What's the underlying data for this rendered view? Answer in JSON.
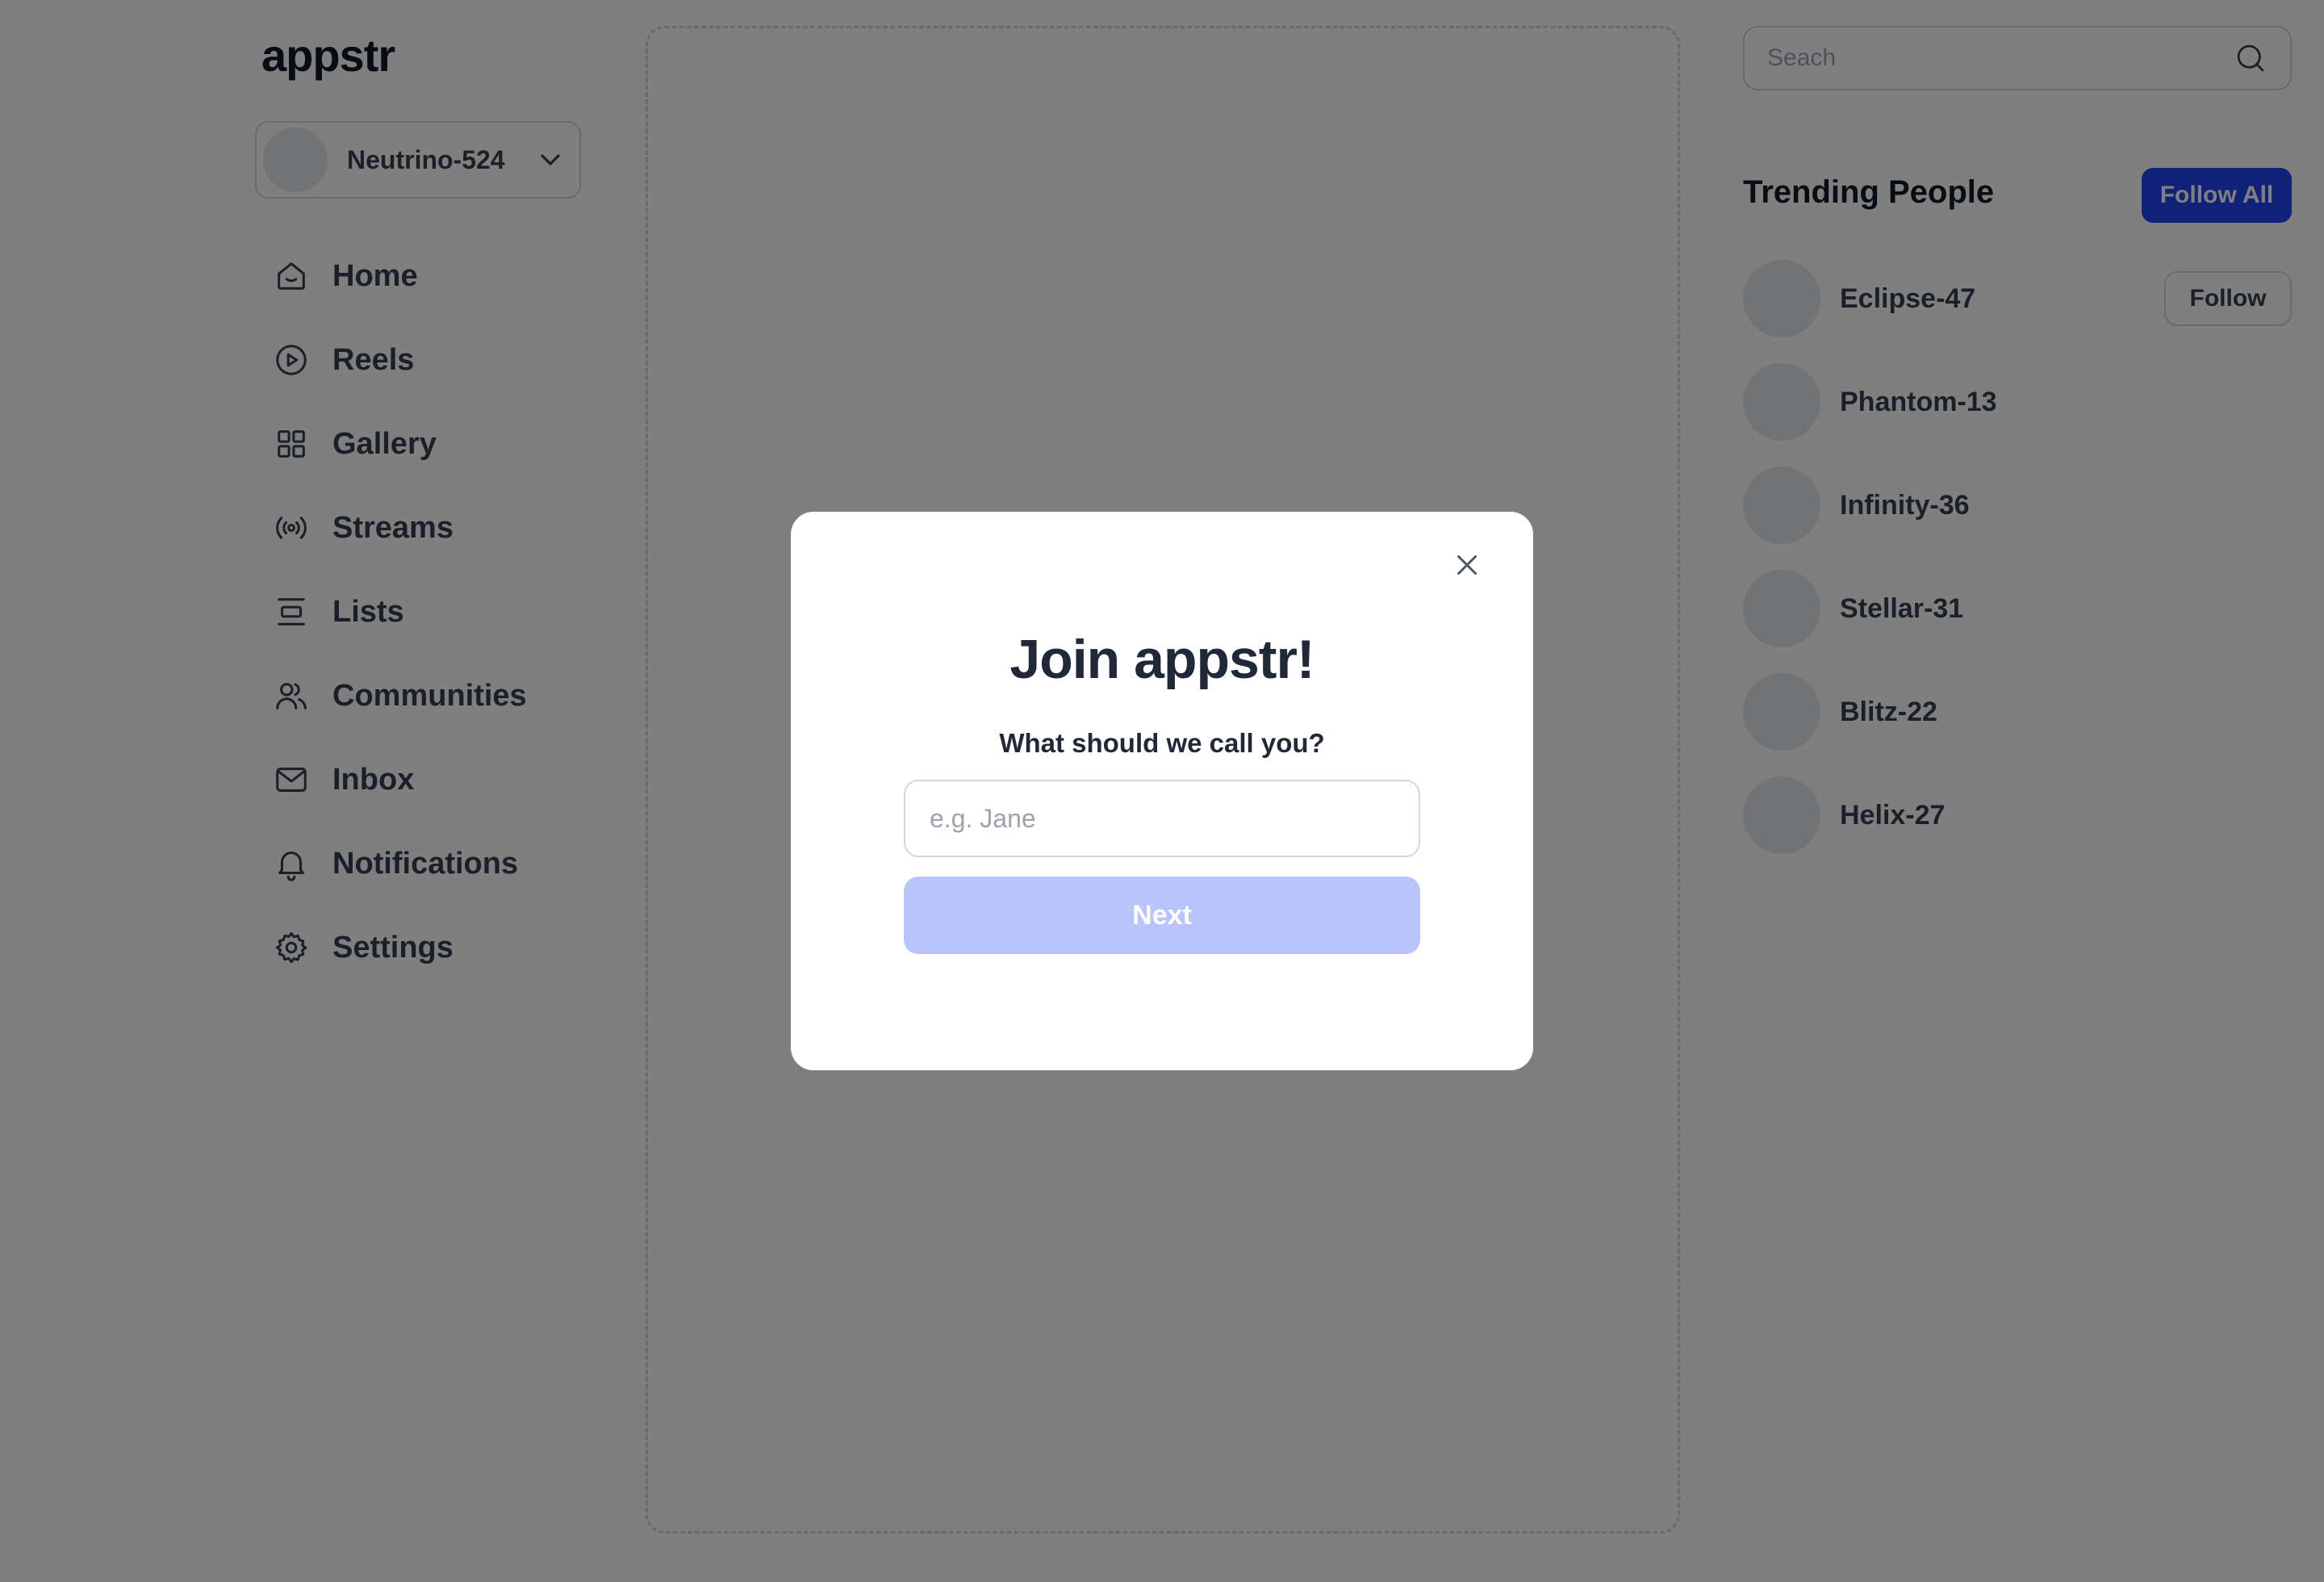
{
  "app": {
    "name": "appstr"
  },
  "account": {
    "username": "Neutrino-524"
  },
  "nav": {
    "items": [
      {
        "label": "Home",
        "icon": "home-icon"
      },
      {
        "label": "Reels",
        "icon": "play-circle-icon"
      },
      {
        "label": "Gallery",
        "icon": "grid-icon"
      },
      {
        "label": "Streams",
        "icon": "broadcast-icon"
      },
      {
        "label": "Lists",
        "icon": "list-icon"
      },
      {
        "label": "Communities",
        "icon": "users-icon"
      },
      {
        "label": "Inbox",
        "icon": "mail-icon"
      },
      {
        "label": "Notifications",
        "icon": "bell-icon"
      },
      {
        "label": "Settings",
        "icon": "gear-icon"
      }
    ]
  },
  "search": {
    "placeholder": "Seach",
    "value": ""
  },
  "trending": {
    "title": "Trending People",
    "follow_all_label": "Follow All",
    "follow_label": "Follow",
    "people": [
      {
        "name": "Eclipse-47"
      },
      {
        "name": "Phantom-13"
      },
      {
        "name": "Infinity-36"
      },
      {
        "name": "Stellar-31"
      },
      {
        "name": "Blitz-22"
      },
      {
        "name": "Helix-27"
      }
    ]
  },
  "modal": {
    "title": "Join appstr!",
    "subtitle": "What should we call you?",
    "input_placeholder": "e.g. Jane",
    "input_value": "",
    "next_label": "Next"
  },
  "colors": {
    "accent": "#2042f5",
    "next_disabled": "#b8c4fb",
    "overlay": "rgba(0,0,0,0.5)"
  }
}
